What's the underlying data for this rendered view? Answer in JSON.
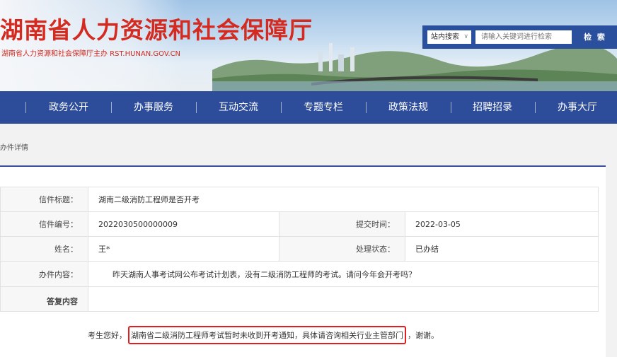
{
  "header": {
    "site_title": "湖南省人力资源和社会保障厅",
    "site_subtitle": "湖南省人力资源和社会保障厅主办  RST.HUNAN.GOV.CN",
    "search": {
      "scope": "站内搜索",
      "placeholder": "请输入关键词进行检索",
      "button": "检 索"
    }
  },
  "nav": {
    "items": [
      "政务公开",
      "办事服务",
      "互动交流",
      "专题专栏",
      "政策法规",
      "招聘招录",
      "办事大厅"
    ]
  },
  "breadcrumb": "办件详情",
  "detail": {
    "title_label": "信件标题：",
    "title_value": "湖南二级消防工程师是否开考",
    "number_label": "信件编号：",
    "number_value": "2022030500000009",
    "submit_time_label": "提交时间：",
    "submit_time_value": "2022-03-05",
    "name_label": "姓名：",
    "name_value": "王*",
    "status_label": "处理状态：",
    "status_value": "已办结",
    "content_label": "办件内容：",
    "content_value": "昨天湖南人事考试网公布考试计划表，没有二级消防工程师的考试。请问今年会开考吗？",
    "reply_label": "答复内容",
    "reply_prefix": "考生您好，",
    "reply_highlight": "湖南省二级消防工程师考试暂时未收到开考通知，具体请咨询相关行业主管部门",
    "reply_suffix": "，谢谢。"
  },
  "colors": {
    "title_red": "#d42a1f",
    "nav_blue": "#2d4d9b",
    "highlight_red": "#e02020"
  }
}
